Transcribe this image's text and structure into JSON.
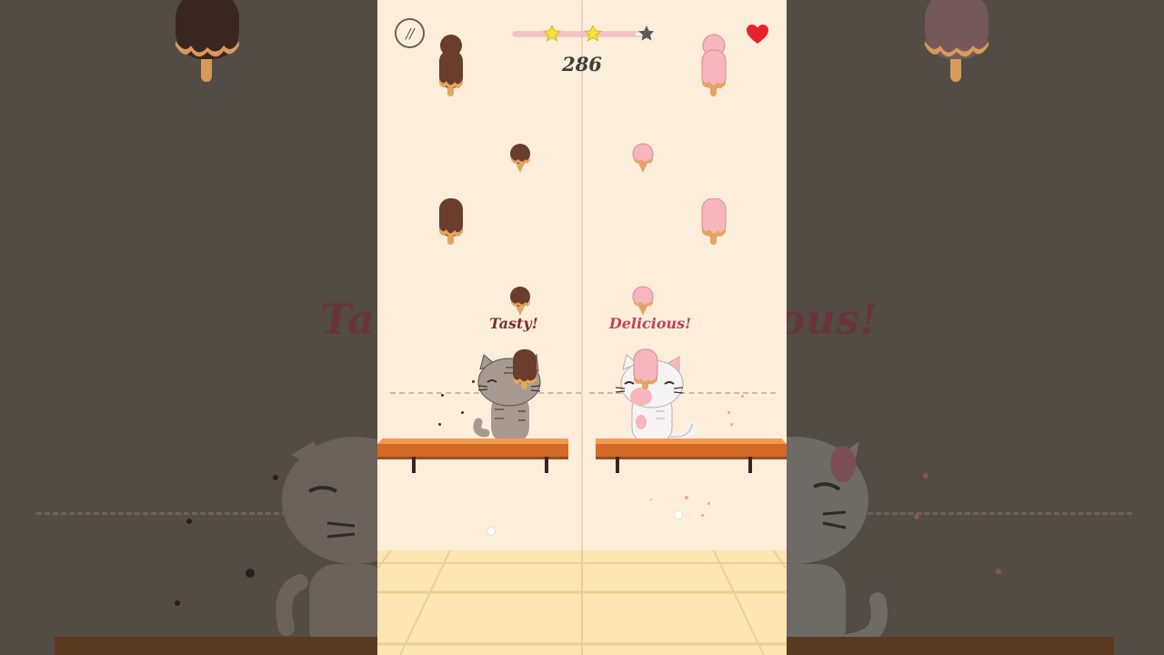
{
  "game": {
    "score": "286",
    "stars_earned": 2,
    "stars_total": 3,
    "lives": 1
  },
  "labels": {
    "left": "Tasty!",
    "right": "Delicious!"
  },
  "backdrop": {
    "left_text": "Ta",
    "right_text": "ous!"
  },
  "icons": {
    "pause": "pause-icon",
    "heart": "heart-icon",
    "star": "star-icon"
  },
  "colors": {
    "background": "#fdeedb",
    "chocolate": "#6a3d2d",
    "strawberry": "#f7b6bd",
    "shelf": "#e07b32",
    "star_gold": "#f7e23f",
    "star_empty": "#5a5a5a",
    "heart": "#e8212b",
    "label_left": "#7a2f2f",
    "label_right": "#c0415a"
  }
}
